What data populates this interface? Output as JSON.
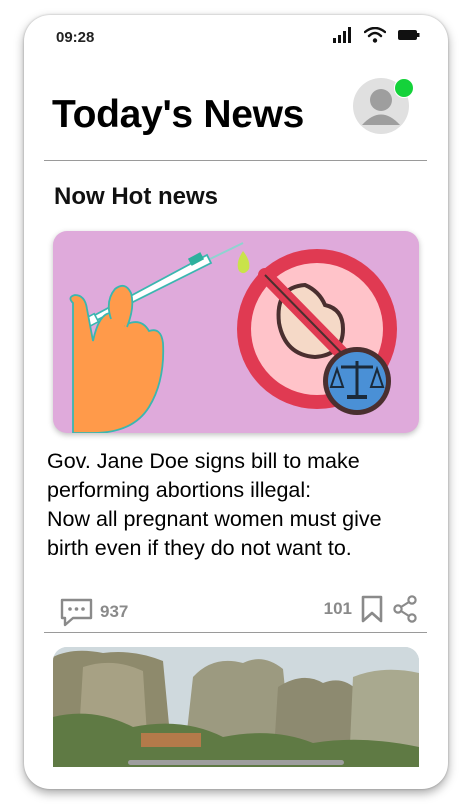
{
  "status_bar": {
    "time": "09:28"
  },
  "header": {
    "title": "Today's News"
  },
  "section": {
    "title": "Now Hot news"
  },
  "article": {
    "headline_lines": [
      "Gov. Jane Doe signs bill to make",
      "performing abortions illegal:",
      "Now all pregnant women must give",
      "birth even if they do not want to."
    ],
    "comments_count": "937",
    "likes_count": "101"
  },
  "colors": {
    "hero_bg": "#dfaadb",
    "online": "#14d23a",
    "meta_text": "#8a8a8a"
  },
  "icons": [
    "signal-icon",
    "wifi-icon",
    "battery-icon",
    "avatar-icon",
    "comment-icon",
    "bookmark-icon",
    "share-icon"
  ]
}
